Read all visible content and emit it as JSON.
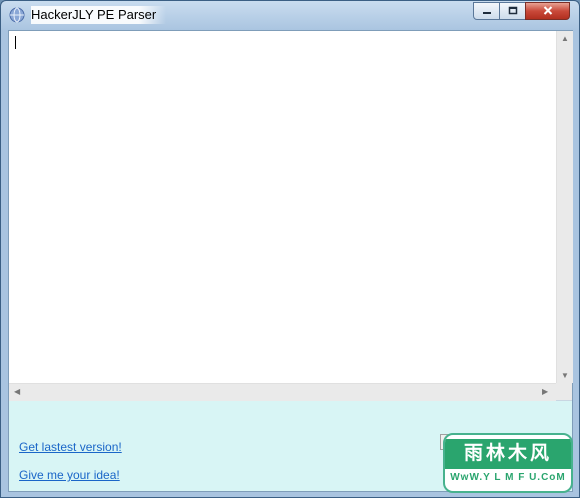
{
  "window": {
    "title": "HackerJLY PE Parser",
    "icons": {
      "app": "app-globe-icon",
      "minimize": "minimize-icon",
      "maximize": "maximize-icon",
      "close": "close-icon"
    }
  },
  "editor": {
    "content": ""
  },
  "links": {
    "latest_version": "Get lastest version!",
    "feedback": "Give me your idea!"
  },
  "watermark": {
    "logo_text": "雨林木风",
    "url": "WwW.Y L M F U.CoM"
  },
  "colors": {
    "link": "#1a66c8",
    "panel_bg": "#d8f5f5",
    "watermark_green": "#2aa56e"
  }
}
